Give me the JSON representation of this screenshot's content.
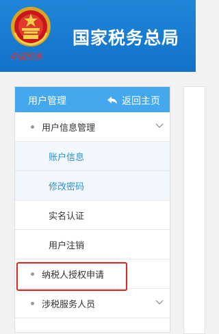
{
  "header": {
    "site_title": "国家税务总局",
    "seal_text": "中国税务",
    "background_color": "#1576cc",
    "emblem_icon": "national-emblem-icon"
  },
  "sidebar": {
    "title": "用户管理",
    "back_label": "返回主页",
    "back_icon": "return-arrow-icon",
    "header_color": "#43a8ee",
    "items": [
      {
        "label": "用户信息管理",
        "type": "group",
        "expanded": true
      },
      {
        "label": "账户信息",
        "type": "sub",
        "active": true
      },
      {
        "label": "修改密码",
        "type": "sub",
        "active": true
      },
      {
        "label": "实名认证",
        "type": "sub",
        "active": false
      },
      {
        "label": "用户注销",
        "type": "sub",
        "active": false
      },
      {
        "label": "纳税人授权申请",
        "type": "item",
        "highlighted": true
      },
      {
        "label": "涉税服务人员",
        "type": "group",
        "expanded": false
      }
    ]
  },
  "colors": {
    "active_text": "#2a93d5",
    "highlight_border": "#e0251f"
  }
}
